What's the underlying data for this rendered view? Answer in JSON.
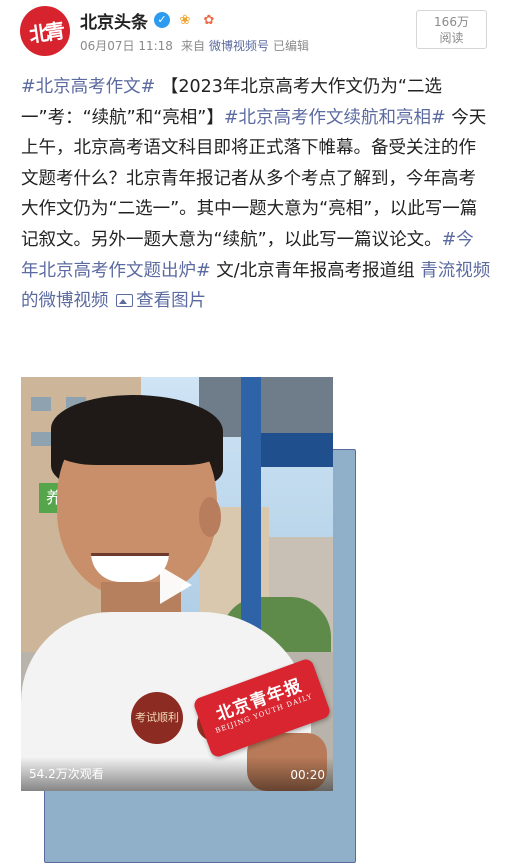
{
  "header": {
    "avatar_text": "北青",
    "name": "北京头条",
    "verified_icon": "verified-check-icon",
    "badges": [
      "fan-club-badge-icon",
      "membership-badge-icon"
    ],
    "date": "06月07日 11:18",
    "from_label": "来自",
    "source": "微博视频号",
    "edited": "已编辑",
    "reads_count": "166万",
    "reads_label": "阅读"
  },
  "post": {
    "topic1": "#北京高考作文#",
    "text1": " 【2023年北京高考大作文仍为“二选一”考：“续航”和“亮相”】",
    "topic2": "#北京高考作文续航和亮相#",
    "text2": " 今天上午，北京高考语文科目即将正式落下帷幕。备受关注的作文题考什么？北京青年报记者从多个考点了解到，今年高考大作文仍为“二选一”。其中一题大意为“亮相”，以此写一篇记叙文。另外一题大意为“续航”，以此写一篇议论文。",
    "topic3": "#今年北京高考作文题出炉#",
    "text3": " 文/北京青年报高考报道组",
    "video_link": "青流视频的微博视频",
    "image_link": "查看图片"
  },
  "video": {
    "views": "54.2万次观看",
    "duration": "00:20",
    "mic_cn": "北京青年报",
    "mic_en": "BEIJING YOUTH DAILY",
    "shirt_text": "考试顺利",
    "sign_text": "养"
  }
}
